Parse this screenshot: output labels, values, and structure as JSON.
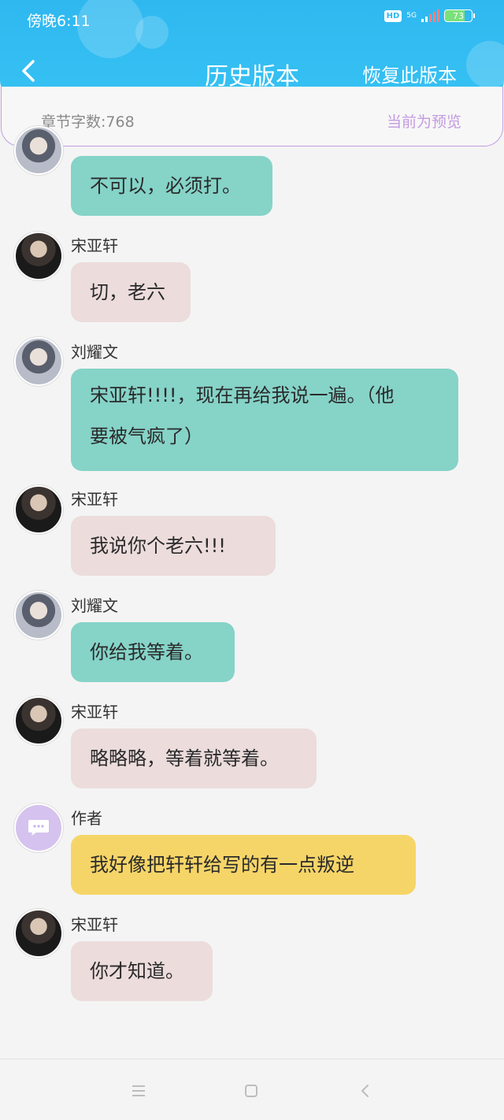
{
  "status": {
    "time": "傍晚6:11",
    "hd": "HD",
    "net": "5G",
    "battery": "73"
  },
  "header": {
    "title": "历史版本",
    "restore": "恢复此版本"
  },
  "info": {
    "word_count": "章节字数:768",
    "preview": "当前为预览"
  },
  "messages": [
    {
      "sender": "",
      "text": "不可以，必须打。",
      "color": "teal"
    },
    {
      "sender": "宋亚轩",
      "text": "切，老六",
      "color": "pink"
    },
    {
      "sender": "刘耀文",
      "text_lines": [
        "宋亚轩!!!!，现在再给我说一遍。（他",
        "要被气疯了）"
      ],
      "color": "teal"
    },
    {
      "sender": "宋亚轩",
      "text": "我说你个老六!!!",
      "color": "pink"
    },
    {
      "sender": "刘耀文",
      "text": "你给我等着。",
      "color": "teal"
    },
    {
      "sender": "宋亚轩",
      "text": "略略略，等着就等着。",
      "color": "pink"
    },
    {
      "sender": "作者",
      "text": "我好像把轩轩给写的有一点叛逆",
      "color": "yellow"
    },
    {
      "sender": "宋亚轩",
      "text": "你才知道。",
      "color": "pink"
    }
  ],
  "icons": [
    "back-chevron-icon",
    "signal-icon",
    "battery-icon",
    "chat-bubble-icon",
    "menu-icon",
    "home-icon",
    "back-icon"
  ],
  "colors": {
    "header": "#2fb8f0",
    "accent_purple": "#c49be0",
    "teal_bubble": "#86d3c8",
    "pink_bubble": "#ecdcdc",
    "yellow_bubble": "#f6d568"
  }
}
